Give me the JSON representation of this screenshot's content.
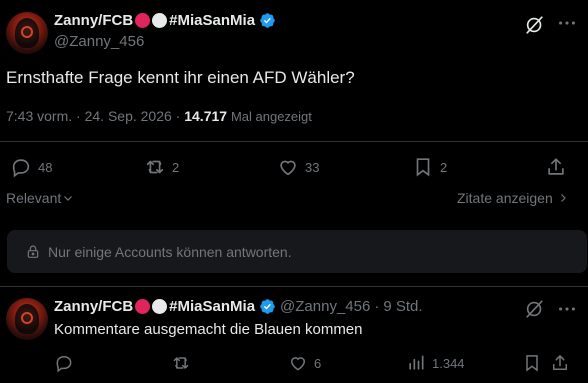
{
  "tweet": {
    "display_name": "Zanny/FCB",
    "name_suffix": "#MiaSanMia",
    "handle": "@Zanny_456",
    "text": "Ernsthafte Frage kennt ihr einen AFD Wähler?",
    "time": "7:43 vorm.",
    "date": "24. Sep. 2026",
    "views_count": "14.717",
    "views_label": "Mal angezeigt",
    "replies": "48",
    "retweets": "2",
    "likes": "33",
    "bookmarks": "2"
  },
  "sort": {
    "label": "Relevant",
    "quotes_label": "Zitate anzeigen"
  },
  "reply_notice": "Nur einige Accounts können antworten.",
  "reply": {
    "display_name": "Zanny/FCB",
    "name_suffix": "#MiaSanMia",
    "handle": "@Zanny_456",
    "age": "9 Std.",
    "text": "Kommentare ausgemacht die Blauen kommen",
    "likes": "6",
    "views": "1.344"
  },
  "colors": {
    "background": "#000000",
    "text": "#e7e9ea",
    "muted": "#71767b",
    "verified": "#1d9bf0",
    "red_dot": "#e0245e",
    "white_dot": "#e7e9ea",
    "notice_bg": "#16181c",
    "divider": "#2f3336"
  },
  "icons": [
    "grok-icon",
    "verified-badge-icon",
    "reply-icon",
    "retweet-icon",
    "like-icon",
    "bookmark-icon",
    "share-icon",
    "chevron-down-icon",
    "chevron-right-icon",
    "lock-icon",
    "views-icon"
  ]
}
